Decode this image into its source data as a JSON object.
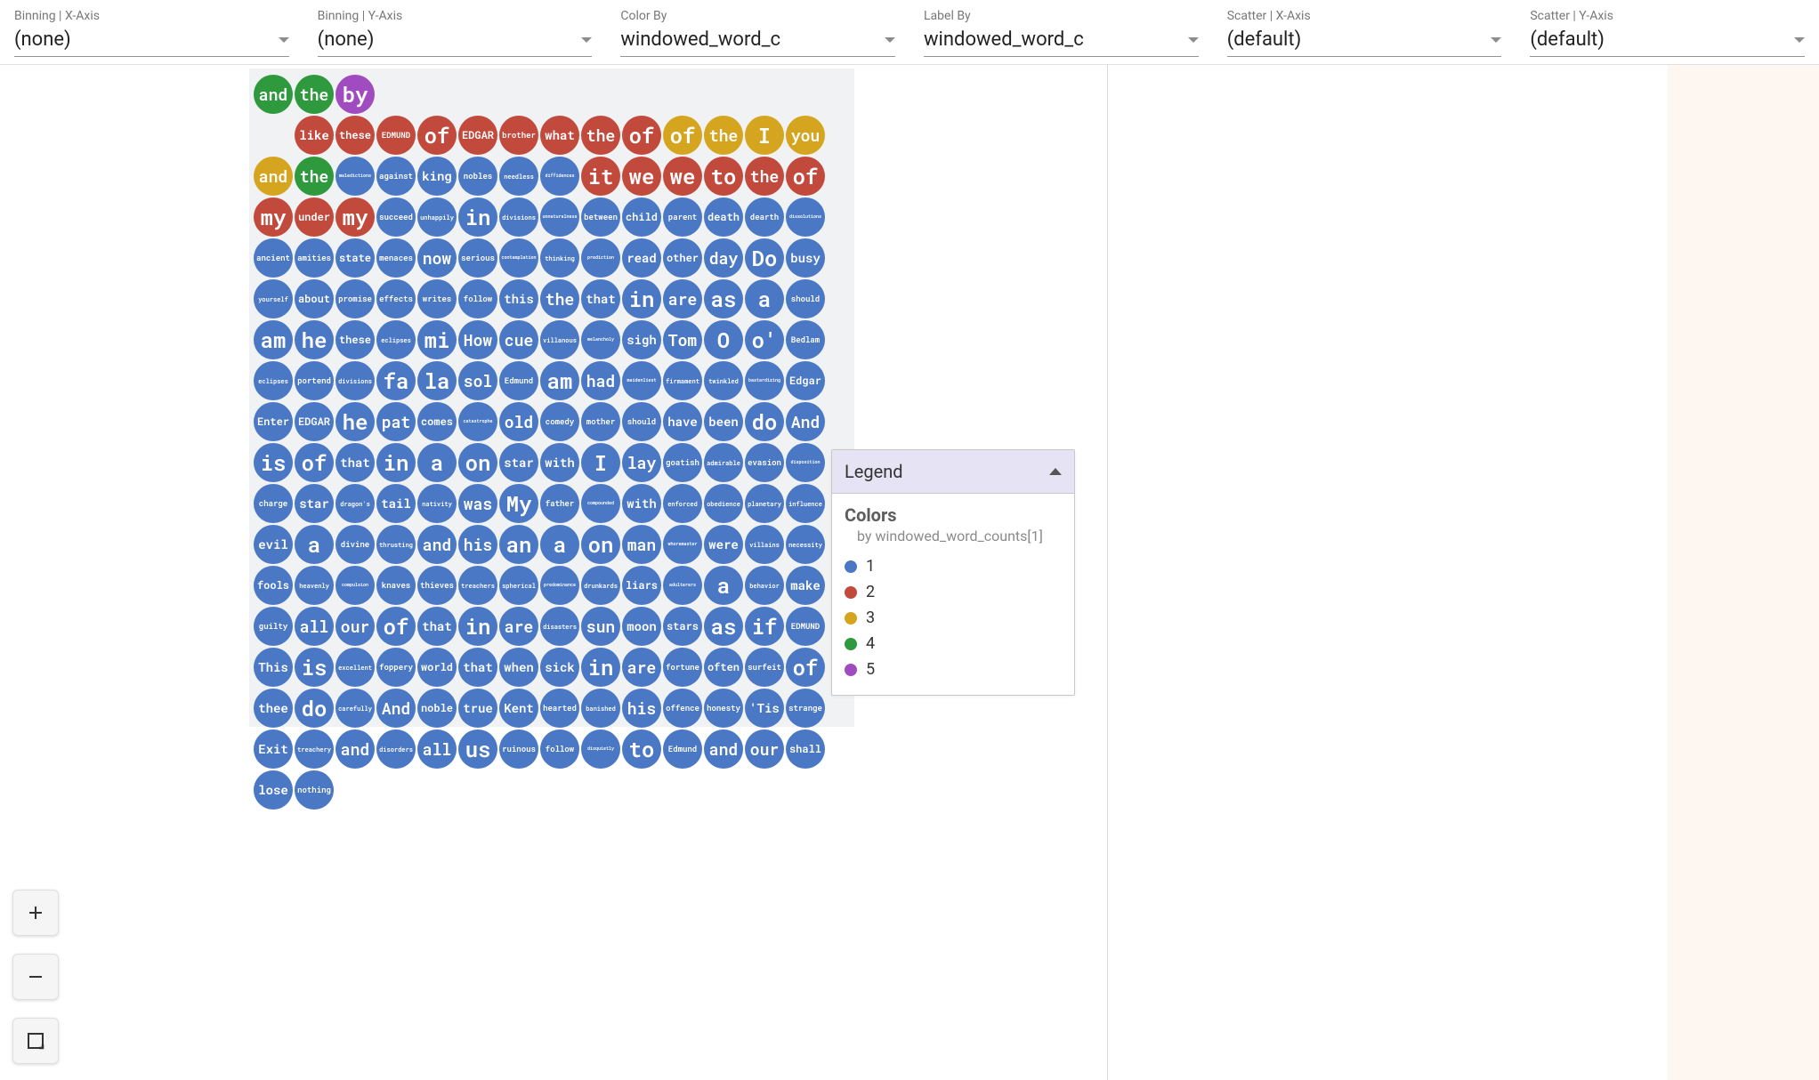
{
  "controls": [
    {
      "name": "binning-x",
      "label": "Binning | X-Axis",
      "value": "(none)"
    },
    {
      "name": "binning-y",
      "label": "Binning | Y-Axis",
      "value": "(none)"
    },
    {
      "name": "color-by",
      "label": "Color By",
      "value": "windowed_word_c"
    },
    {
      "name": "label-by",
      "label": "Label By",
      "value": "windowed_word_c"
    },
    {
      "name": "scatter-x",
      "label": "Scatter | X-Axis",
      "value": "(default)"
    },
    {
      "name": "scatter-y",
      "label": "Scatter | Y-Axis",
      "value": "(default)"
    }
  ],
  "legend": {
    "title": "Legend",
    "section": "Colors",
    "subtitle": "by windowed_word_counts[1]",
    "items": [
      {
        "value": "1",
        "color": "#4a78c4"
      },
      {
        "value": "2",
        "color": "#c24a3d"
      },
      {
        "value": "3",
        "color": "#d6a51f"
      },
      {
        "value": "4",
        "color": "#2f9a3d"
      },
      {
        "value": "5",
        "color": "#a14bc1"
      }
    ]
  },
  "bubbles": [
    {
      "t": "and",
      "c": 4
    },
    {
      "t": "the",
      "c": 4
    },
    {
      "t": "by",
      "c": 5
    },
    {
      "t": "",
      "c": 0
    },
    {
      "t": "",
      "c": 0
    },
    {
      "t": "",
      "c": 0
    },
    {
      "t": "",
      "c": 0
    },
    {
      "t": "",
      "c": 0
    },
    {
      "t": "",
      "c": 0
    },
    {
      "t": "",
      "c": 0
    },
    {
      "t": "",
      "c": 0
    },
    {
      "t": "",
      "c": 0
    },
    {
      "t": "",
      "c": 0
    },
    {
      "t": "",
      "c": 0
    },
    {
      "t": "",
      "c": 0
    },
    {
      "t": "like",
      "c": 2
    },
    {
      "t": "these",
      "c": 2
    },
    {
      "t": "EDMUND",
      "c": 2
    },
    {
      "t": "of",
      "c": 2
    },
    {
      "t": "EDGAR",
      "c": 2
    },
    {
      "t": "brother",
      "c": 2
    },
    {
      "t": "what",
      "c": 2
    },
    {
      "t": "the",
      "c": 2
    },
    {
      "t": "of",
      "c": 2
    },
    {
      "t": "of",
      "c": 3
    },
    {
      "t": "the",
      "c": 3
    },
    {
      "t": "I",
      "c": 3
    },
    {
      "t": "you",
      "c": 3
    },
    {
      "t": "and",
      "c": 3
    },
    {
      "t": "the",
      "c": 4
    },
    {
      "t": "maledictions",
      "c": 1
    },
    {
      "t": "against",
      "c": 1
    },
    {
      "t": "king",
      "c": 1
    },
    {
      "t": "nobles",
      "c": 1
    },
    {
      "t": "needless",
      "c": 1
    },
    {
      "t": "diffidences",
      "c": 1
    },
    {
      "t": "it",
      "c": 2
    },
    {
      "t": "we",
      "c": 2
    },
    {
      "t": "we",
      "c": 2
    },
    {
      "t": "to",
      "c": 2
    },
    {
      "t": "the",
      "c": 2
    },
    {
      "t": "of",
      "c": 2
    },
    {
      "t": "my",
      "c": 2
    },
    {
      "t": "under",
      "c": 2
    },
    {
      "t": "my",
      "c": 2
    },
    {
      "t": "succeed",
      "c": 1
    },
    {
      "t": "unhappily",
      "c": 1
    },
    {
      "t": "in",
      "c": 1
    },
    {
      "t": "divisions",
      "c": 1
    },
    {
      "t": "unnaturalness",
      "c": 1
    },
    {
      "t": "between",
      "c": 1
    },
    {
      "t": "child",
      "c": 1
    },
    {
      "t": "parent",
      "c": 1
    },
    {
      "t": "death",
      "c": 1
    },
    {
      "t": "dearth",
      "c": 1
    },
    {
      "t": "dissolutions",
      "c": 1
    },
    {
      "t": "ancient",
      "c": 1
    },
    {
      "t": "amities",
      "c": 1
    },
    {
      "t": "state",
      "c": 1
    },
    {
      "t": "menaces",
      "c": 1
    },
    {
      "t": "now",
      "c": 1
    },
    {
      "t": "serious",
      "c": 1
    },
    {
      "t": "contemplation",
      "c": 1
    },
    {
      "t": "thinking",
      "c": 1
    },
    {
      "t": "prediction",
      "c": 1
    },
    {
      "t": "read",
      "c": 1
    },
    {
      "t": "other",
      "c": 1
    },
    {
      "t": "day",
      "c": 1
    },
    {
      "t": "Do",
      "c": 1
    },
    {
      "t": "busy",
      "c": 1
    },
    {
      "t": "yourself",
      "c": 1
    },
    {
      "t": "about",
      "c": 1
    },
    {
      "t": "promise",
      "c": 1
    },
    {
      "t": "effects",
      "c": 1
    },
    {
      "t": "writes",
      "c": 1
    },
    {
      "t": "follow",
      "c": 1
    },
    {
      "t": "this",
      "c": 1
    },
    {
      "t": "the",
      "c": 1
    },
    {
      "t": "that",
      "c": 1
    },
    {
      "t": "in",
      "c": 1
    },
    {
      "t": "are",
      "c": 1
    },
    {
      "t": "as",
      "c": 1
    },
    {
      "t": "a",
      "c": 1
    },
    {
      "t": "should",
      "c": 1
    },
    {
      "t": "am",
      "c": 1
    },
    {
      "t": "he",
      "c": 1
    },
    {
      "t": "these",
      "c": 1
    },
    {
      "t": "eclipses",
      "c": 1
    },
    {
      "t": "mi",
      "c": 1
    },
    {
      "t": "How",
      "c": 1
    },
    {
      "t": "cue",
      "c": 1
    },
    {
      "t": "villanous",
      "c": 1
    },
    {
      "t": "melancholy",
      "c": 1
    },
    {
      "t": "sigh",
      "c": 1
    },
    {
      "t": "Tom",
      "c": 1
    },
    {
      "t": "O",
      "c": 1
    },
    {
      "t": "o'",
      "c": 1
    },
    {
      "t": "Bedlam",
      "c": 1
    },
    {
      "t": "eclipses",
      "c": 1
    },
    {
      "t": "portend",
      "c": 1
    },
    {
      "t": "divisions",
      "c": 1
    },
    {
      "t": "fa",
      "c": 1
    },
    {
      "t": "la",
      "c": 1
    },
    {
      "t": "sol",
      "c": 1
    },
    {
      "t": "Edmund",
      "c": 1
    },
    {
      "t": "am",
      "c": 1
    },
    {
      "t": "had",
      "c": 1
    },
    {
      "t": "maidenliest",
      "c": 1
    },
    {
      "t": "firmament",
      "c": 1
    },
    {
      "t": "twinkled",
      "c": 1
    },
    {
      "t": "bastardizing",
      "c": 1
    },
    {
      "t": "Edgar",
      "c": 1
    },
    {
      "t": "Enter",
      "c": 1
    },
    {
      "t": "EDGAR",
      "c": 1
    },
    {
      "t": "he",
      "c": 1
    },
    {
      "t": "pat",
      "c": 1
    },
    {
      "t": "comes",
      "c": 1
    },
    {
      "t": "catastrophe",
      "c": 1
    },
    {
      "t": "old",
      "c": 1
    },
    {
      "t": "comedy",
      "c": 1
    },
    {
      "t": "mother",
      "c": 1
    },
    {
      "t": "should",
      "c": 1
    },
    {
      "t": "have",
      "c": 1
    },
    {
      "t": "been",
      "c": 1
    },
    {
      "t": "do",
      "c": 1
    },
    {
      "t": "And",
      "c": 1
    },
    {
      "t": "is",
      "c": 1
    },
    {
      "t": "of",
      "c": 1
    },
    {
      "t": "that",
      "c": 1
    },
    {
      "t": "in",
      "c": 1
    },
    {
      "t": "a",
      "c": 1
    },
    {
      "t": "on",
      "c": 1
    },
    {
      "t": "star",
      "c": 1
    },
    {
      "t": "with",
      "c": 1
    },
    {
      "t": "I",
      "c": 1
    },
    {
      "t": "lay",
      "c": 1
    },
    {
      "t": "goatish",
      "c": 1
    },
    {
      "t": "admirable",
      "c": 1
    },
    {
      "t": "evasion",
      "c": 1
    },
    {
      "t": "disposition",
      "c": 1
    },
    {
      "t": "charge",
      "c": 1
    },
    {
      "t": "star",
      "c": 1
    },
    {
      "t": "dragon's",
      "c": 1
    },
    {
      "t": "tail",
      "c": 1
    },
    {
      "t": "nativity",
      "c": 1
    },
    {
      "t": "was",
      "c": 1
    },
    {
      "t": "My",
      "c": 1
    },
    {
      "t": "father",
      "c": 1
    },
    {
      "t": "compounded",
      "c": 1
    },
    {
      "t": "with",
      "c": 1
    },
    {
      "t": "enforced",
      "c": 1
    },
    {
      "t": "obedience",
      "c": 1
    },
    {
      "t": "planetary",
      "c": 1
    },
    {
      "t": "influence",
      "c": 1
    },
    {
      "t": "evil",
      "c": 1
    },
    {
      "t": "a",
      "c": 1
    },
    {
      "t": "divine",
      "c": 1
    },
    {
      "t": "thrusting",
      "c": 1
    },
    {
      "t": "and",
      "c": 1
    },
    {
      "t": "his",
      "c": 1
    },
    {
      "t": "an",
      "c": 1
    },
    {
      "t": "a",
      "c": 1
    },
    {
      "t": "on",
      "c": 1
    },
    {
      "t": "man",
      "c": 1
    },
    {
      "t": "whoremaster",
      "c": 1
    },
    {
      "t": "were",
      "c": 1
    },
    {
      "t": "villains",
      "c": 1
    },
    {
      "t": "necessity",
      "c": 1
    },
    {
      "t": "fools",
      "c": 1
    },
    {
      "t": "heavenly",
      "c": 1
    },
    {
      "t": "compulsion",
      "c": 1
    },
    {
      "t": "knaves",
      "c": 1
    },
    {
      "t": "thieves",
      "c": 1
    },
    {
      "t": "treachers",
      "c": 1
    },
    {
      "t": "spherical",
      "c": 1
    },
    {
      "t": "predominance",
      "c": 1
    },
    {
      "t": "drunkards",
      "c": 1
    },
    {
      "t": "liars",
      "c": 1
    },
    {
      "t": "adulterers",
      "c": 1
    },
    {
      "t": "a",
      "c": 1
    },
    {
      "t": "behavior",
      "c": 1
    },
    {
      "t": "make",
      "c": 1
    },
    {
      "t": "guilty",
      "c": 1
    },
    {
      "t": "all",
      "c": 1
    },
    {
      "t": "our",
      "c": 1
    },
    {
      "t": "of",
      "c": 1
    },
    {
      "t": "that",
      "c": 1
    },
    {
      "t": "in",
      "c": 1
    },
    {
      "t": "are",
      "c": 1
    },
    {
      "t": "disasters",
      "c": 1
    },
    {
      "t": "sun",
      "c": 1
    },
    {
      "t": "moon",
      "c": 1
    },
    {
      "t": "stars",
      "c": 1
    },
    {
      "t": "as",
      "c": 1
    },
    {
      "t": "if",
      "c": 1
    },
    {
      "t": "EDMUND",
      "c": 1
    },
    {
      "t": "This",
      "c": 1
    },
    {
      "t": "is",
      "c": 1
    },
    {
      "t": "excellent",
      "c": 1
    },
    {
      "t": "foppery",
      "c": 1
    },
    {
      "t": "world",
      "c": 1
    },
    {
      "t": "that",
      "c": 1
    },
    {
      "t": "when",
      "c": 1
    },
    {
      "t": "sick",
      "c": 1
    },
    {
      "t": "in",
      "c": 1
    },
    {
      "t": "are",
      "c": 1
    },
    {
      "t": "fortune",
      "c": 1
    },
    {
      "t": "often",
      "c": 1
    },
    {
      "t": "surfeit",
      "c": 1
    },
    {
      "t": "of",
      "c": 1
    },
    {
      "t": "thee",
      "c": 1
    },
    {
      "t": "do",
      "c": 1
    },
    {
      "t": "carefully",
      "c": 1
    },
    {
      "t": "And",
      "c": 1
    },
    {
      "t": "noble",
      "c": 1
    },
    {
      "t": "true",
      "c": 1
    },
    {
      "t": "Kent",
      "c": 1
    },
    {
      "t": "hearted",
      "c": 1
    },
    {
      "t": "banished",
      "c": 1
    },
    {
      "t": "his",
      "c": 1
    },
    {
      "t": "offence",
      "c": 1
    },
    {
      "t": "honesty",
      "c": 1
    },
    {
      "t": "'Tis",
      "c": 1
    },
    {
      "t": "strange",
      "c": 1
    },
    {
      "t": "Exit",
      "c": 1
    },
    {
      "t": "treachery",
      "c": 1
    },
    {
      "t": "and",
      "c": 1
    },
    {
      "t": "disorders",
      "c": 1
    },
    {
      "t": "all",
      "c": 1
    },
    {
      "t": "us",
      "c": 1
    },
    {
      "t": "ruinous",
      "c": 1
    },
    {
      "t": "follow",
      "c": 1
    },
    {
      "t": "disquietly",
      "c": 1
    },
    {
      "t": "to",
      "c": 1
    },
    {
      "t": "Edmund",
      "c": 1
    },
    {
      "t": "and",
      "c": 1
    },
    {
      "t": "our",
      "c": 1
    },
    {
      "t": "shall",
      "c": 1
    },
    {
      "t": "lose",
      "c": 1
    },
    {
      "t": "nothing",
      "c": 1
    }
  ]
}
